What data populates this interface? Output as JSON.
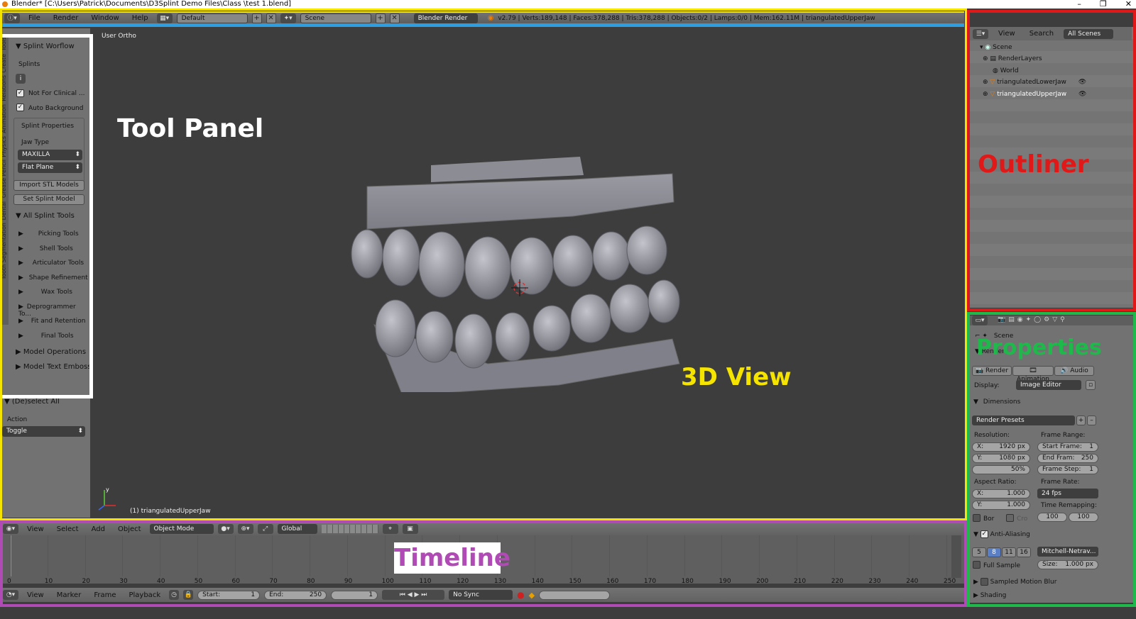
{
  "window": {
    "title": "Blender* [C:\\Users\\Patrick\\Documents\\D3Splint Demo Files\\Class \\test 1.blend]",
    "controls": [
      "–",
      "❐",
      "✕"
    ]
  },
  "info_header": {
    "menus": [
      "File",
      "Render",
      "Window",
      "Help"
    ],
    "screen_layout": "Default",
    "scene": "Scene",
    "render_engine": "Blender Render",
    "status": "v2.79 | Verts:189,148 | Faces:378,288 | Tris:378,288 | Objects:0/2 | Lamps:0/0 | Mem:162.11M | triangulatedUpperJaw"
  },
  "tool_panel": {
    "tabs": [
      "Tools",
      "Create",
      "Relations",
      "Animation",
      "Physics",
      "Grease Pencil",
      "Dental",
      "Tooth Segmentation"
    ],
    "splint_workflow": {
      "heading": "Splint Worflow",
      "splints_label": "Splints",
      "not_clinical": "Not For Clinical ...",
      "auto_background": "Auto Background"
    },
    "splint_properties": {
      "heading": "Splint Properties",
      "jaw_type_label": "Jaw Type",
      "jaw_type_value": "MAXILLA",
      "plane_value": "Flat Plane"
    },
    "import_stl": "Import STL Models",
    "set_splint": "Set Splint Model",
    "all_tools": {
      "heading": "All Splint Tools",
      "items": [
        "Picking Tools",
        "Shell Tools",
        "Articulator Tools",
        "Shape Refinement",
        "Wax Tools",
        "Deprogrammer To...",
        "Fit and Retention",
        "Final Tools"
      ]
    },
    "model_operations": "Model Operations",
    "model_text_emboss": "Model Text Emboss",
    "deselect_all": "(De)select All",
    "action_label": "Action",
    "action_value": "Toggle"
  },
  "viewport": {
    "view_label": "User Ortho",
    "object_label": "(1) triangulatedUpperJaw"
  },
  "annotations": {
    "tool_panel": "Tool Panel",
    "view3d": "3D View",
    "outliner": "Outliner",
    "properties": "Properties",
    "timeline": "Timeline"
  },
  "outliner": {
    "menus": [
      "View",
      "Search"
    ],
    "filter": "All Scenes",
    "items": [
      {
        "label": "Scene"
      },
      {
        "label": "RenderLayers"
      },
      {
        "label": "World"
      },
      {
        "label": "triangulatedLowerJaw"
      },
      {
        "label": "triangulatedUpperJaw"
      }
    ]
  },
  "properties": {
    "context": "Scene",
    "section": "Render",
    "tabs": [
      "Render",
      "Animation",
      "Audio"
    ],
    "display_label": "Display:",
    "display_value": "Image Editor",
    "dimensions_heading": "Dimensions",
    "render_presets": "Render Presets",
    "resolution_label": "Resolution:",
    "res_x": "X:",
    "res_x_val": "1920 px",
    "res_y": "Y:",
    "res_y_val": "1080 px",
    "res_pct": "50%",
    "frame_range_label": "Frame Range:",
    "start_frame": "Start Frame:",
    "start_frame_val": "1",
    "end_frame": "End Fram:",
    "end_frame_val": "250",
    "frame_step": "Frame Step:",
    "frame_step_val": "1",
    "aspect_label": "Aspect Ratio:",
    "aspect_x": "X:",
    "aspect_x_val": "1.000",
    "aspect_y": "Y:",
    "aspect_y_val": "1.000",
    "frame_rate_label": "Frame Rate:",
    "frame_rate_val": "24 fps",
    "time_remap_label": "Time Remapping:",
    "time_remap_old": "100",
    "time_remap_new": "100",
    "border": "Bor",
    "crop": "Cro",
    "aa_heading": "Anti-Aliasing",
    "aa_samples": [
      "5",
      "8",
      "11",
      "16"
    ],
    "aa_filter": "Mitchell-Netrav...",
    "full_sample": "Full Sample",
    "size_label": "Size:",
    "size_val": "1.000 px",
    "motion_blur": "Sampled Motion Blur",
    "shading": "Shading"
  },
  "view3d_header": {
    "menus": [
      "View",
      "Select",
      "Add",
      "Object"
    ],
    "mode": "Object Mode",
    "orientation": "Global"
  },
  "timeline": {
    "ticks": [
      "0",
      "10",
      "20",
      "30",
      "40",
      "50",
      "60",
      "70",
      "80",
      "90",
      "100",
      "110",
      "120",
      "130",
      "140",
      "150",
      "160",
      "170",
      "180",
      "190",
      "200",
      "210",
      "220",
      "230",
      "240",
      "250"
    ],
    "menus": [
      "View",
      "Marker",
      "Frame",
      "Playback"
    ],
    "start_label": "Start:",
    "start_val": "1",
    "end_label": "End:",
    "end_val": "250",
    "current": "1",
    "sync": "No Sync"
  },
  "colors": {
    "view_frame": "#f5e300",
    "info_frame": "#2d9ee0",
    "outliner_frame": "#e01818",
    "properties_frame": "#1eb84b",
    "timeline_frame": "#b04ab4"
  }
}
